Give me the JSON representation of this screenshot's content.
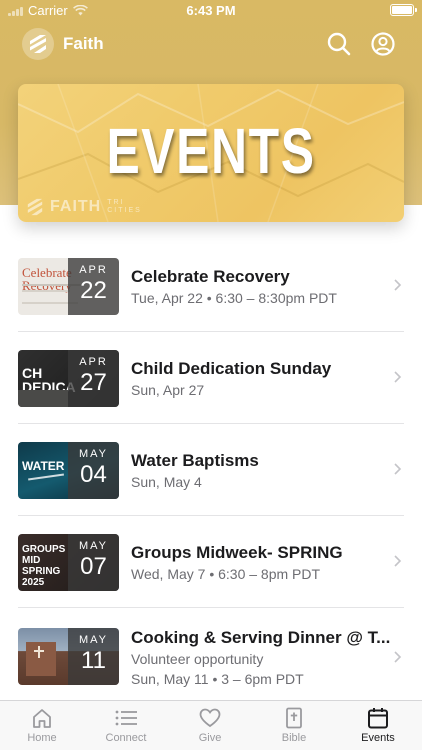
{
  "status_bar": {
    "carrier": "Carrier",
    "time": "6:43 PM"
  },
  "header": {
    "app_name": "Faith"
  },
  "banner": {
    "title": "EVENTS",
    "watermark": "FAITH",
    "watermark_sub": "TRI CITIES"
  },
  "events": [
    {
      "title": "Celebrate Recovery",
      "date": "Tue, Apr 22 • 6:30 – 8:30pm PDT",
      "month": "APR",
      "day": "22",
      "art_text": "Celebrate Recovery"
    },
    {
      "title": "Child Dedication Sunday",
      "date": "Sun, Apr 27",
      "month": "APR",
      "day": "27",
      "art_text": "CH DEDICA"
    },
    {
      "title": "Water Baptisms",
      "date": "Sun, May 4",
      "month": "MAY",
      "day": "04",
      "art_text": "WATER"
    },
    {
      "title": "Groups Midweek- SPRING",
      "date": "Wed, May 7 • 6:30 – 8pm PDT",
      "month": "MAY",
      "day": "07",
      "art_text": "GROUPS MID SPRING 2025"
    },
    {
      "title": "Cooking & Serving Dinner @ T...",
      "subtitle": "Volunteer opportunity",
      "date": "Sun, May 11 • 3 – 6pm PDT",
      "month": "MAY",
      "day": "11"
    }
  ],
  "tabs": [
    {
      "label": "Home",
      "icon": "home-icon"
    },
    {
      "label": "Connect",
      "icon": "list-icon"
    },
    {
      "label": "Give",
      "icon": "heart-icon"
    },
    {
      "label": "Bible",
      "icon": "bible-icon"
    },
    {
      "label": "Events",
      "icon": "calendar-icon",
      "active": true
    }
  ],
  "colors": {
    "header_gold": "#d9b964",
    "banner_gold": "#f0cb6c",
    "secondary_text": "#6d6d72",
    "tab_inactive": "#9a9a9e"
  }
}
